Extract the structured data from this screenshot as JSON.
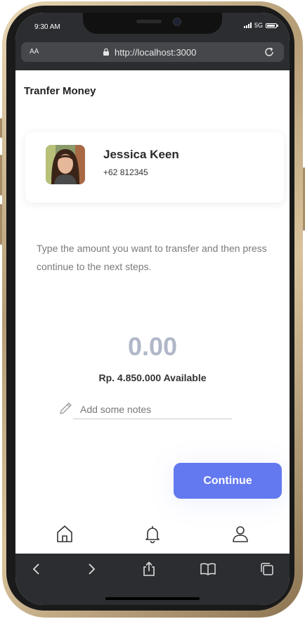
{
  "status_bar": {
    "time": "9:30 AM",
    "network": "5G"
  },
  "browser": {
    "text_size_label": "AA",
    "url": "http://localhost:3000"
  },
  "page": {
    "title": "Tranfer Money"
  },
  "contact": {
    "name": "Jessica Keen",
    "phone": "+62 812345"
  },
  "instruction": "Type the amount you want to transfer and then press continue to the next steps.",
  "amount": "0.00",
  "balance_text": "Rp. 4.850.000 Available",
  "notes": {
    "placeholder": "Add some notes",
    "value": ""
  },
  "continue_label": "Continue",
  "bottom_nav": {
    "items": [
      "home-icon",
      "bell-icon",
      "user-icon"
    ]
  },
  "safari_toolbar": {
    "items": [
      "back-icon",
      "forward-icon",
      "share-icon",
      "bookmarks-icon",
      "tabs-icon"
    ]
  },
  "colors": {
    "accent": "#6379f0",
    "amount": "#b0b7c8",
    "browser_chrome": "#2b2d30"
  }
}
